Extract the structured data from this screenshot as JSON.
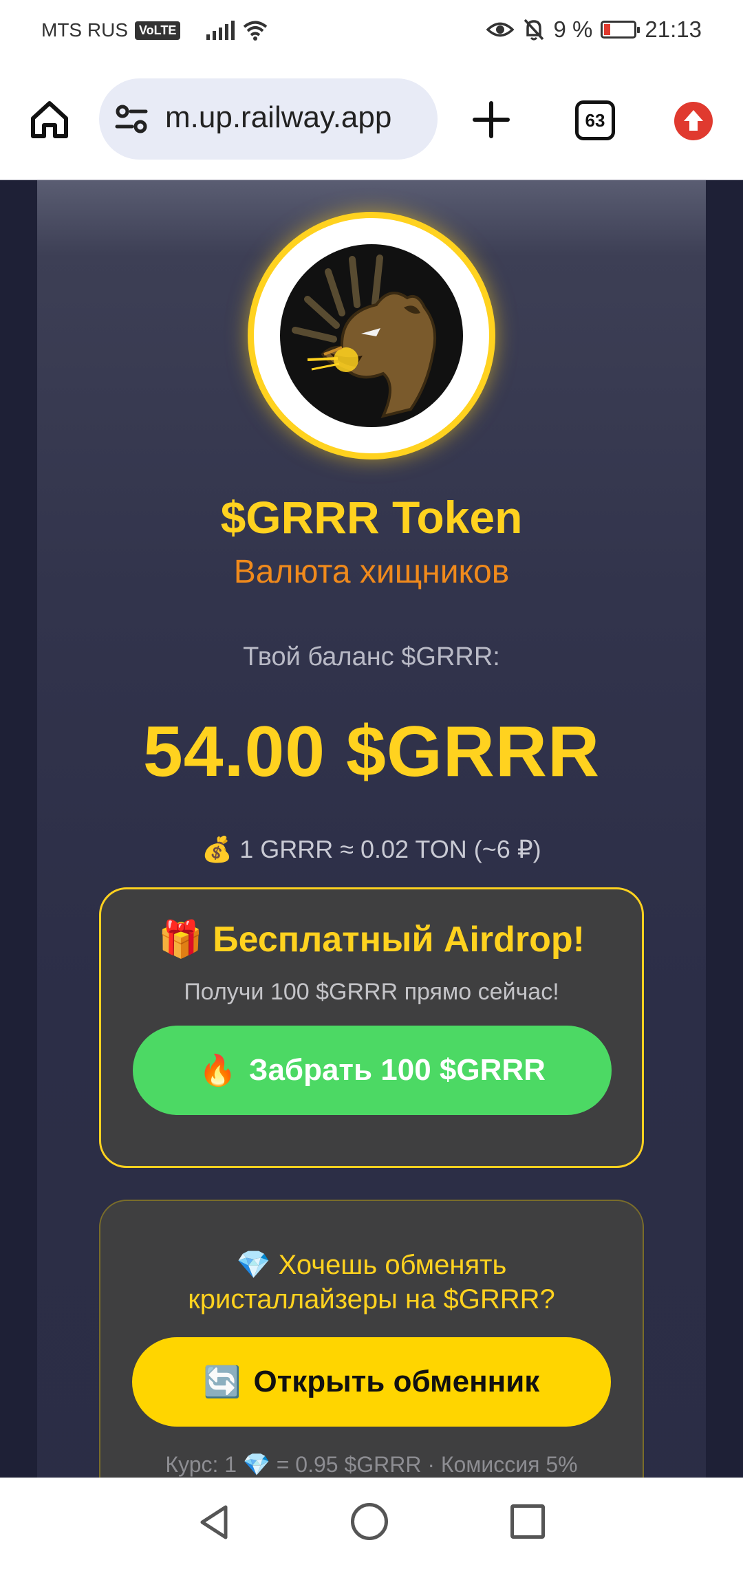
{
  "status_bar": {
    "carrier": "MTS RUS",
    "network_badge": "VoLTE",
    "battery_percent": "9 %",
    "time": "21:13",
    "icons": [
      "signal-icon",
      "wifi-icon",
      "eye-comfort-icon",
      "bell-off-icon",
      "battery-icon"
    ]
  },
  "browser": {
    "url": "m.up.railway.app",
    "tab_count": "63",
    "icons": [
      "home-icon",
      "site-settings-icon",
      "new-tab-icon",
      "tabs-icon",
      "update-icon"
    ]
  },
  "token": {
    "title": "$GRRR Token",
    "subtitle": "Валюта хищников"
  },
  "balance": {
    "label": "Твой баланс $GRRR:",
    "value": "54.00 $GRRR",
    "rate_icon": "💰",
    "rate": "1 GRRR ≈ 0.02 TON (~6 ₽)"
  },
  "airdrop": {
    "icon": "🎁",
    "title": "Бесплатный Airdrop!",
    "text": "Получи 100 $GRRR прямо сейчас!",
    "button_icon": "🔥",
    "button_label": "Забрать 100 $GRRR"
  },
  "exchange": {
    "icon": "💎",
    "line1": "Хочешь обменять",
    "line2": "кристаллайзеры на $GRRR?",
    "button_icon": "🔄",
    "button_label": "Открыть обменник",
    "rate_prefix": "Курс: 1",
    "rate_icon": "💎",
    "rate_suffix": "= 0.95 $GRRR · Комиссия 5%"
  },
  "colors": {
    "accent_yellow": "#ffd21f",
    "orange": "#f08a1c",
    "claim_green": "#4cd964",
    "danger_red": "#e03a2f"
  }
}
